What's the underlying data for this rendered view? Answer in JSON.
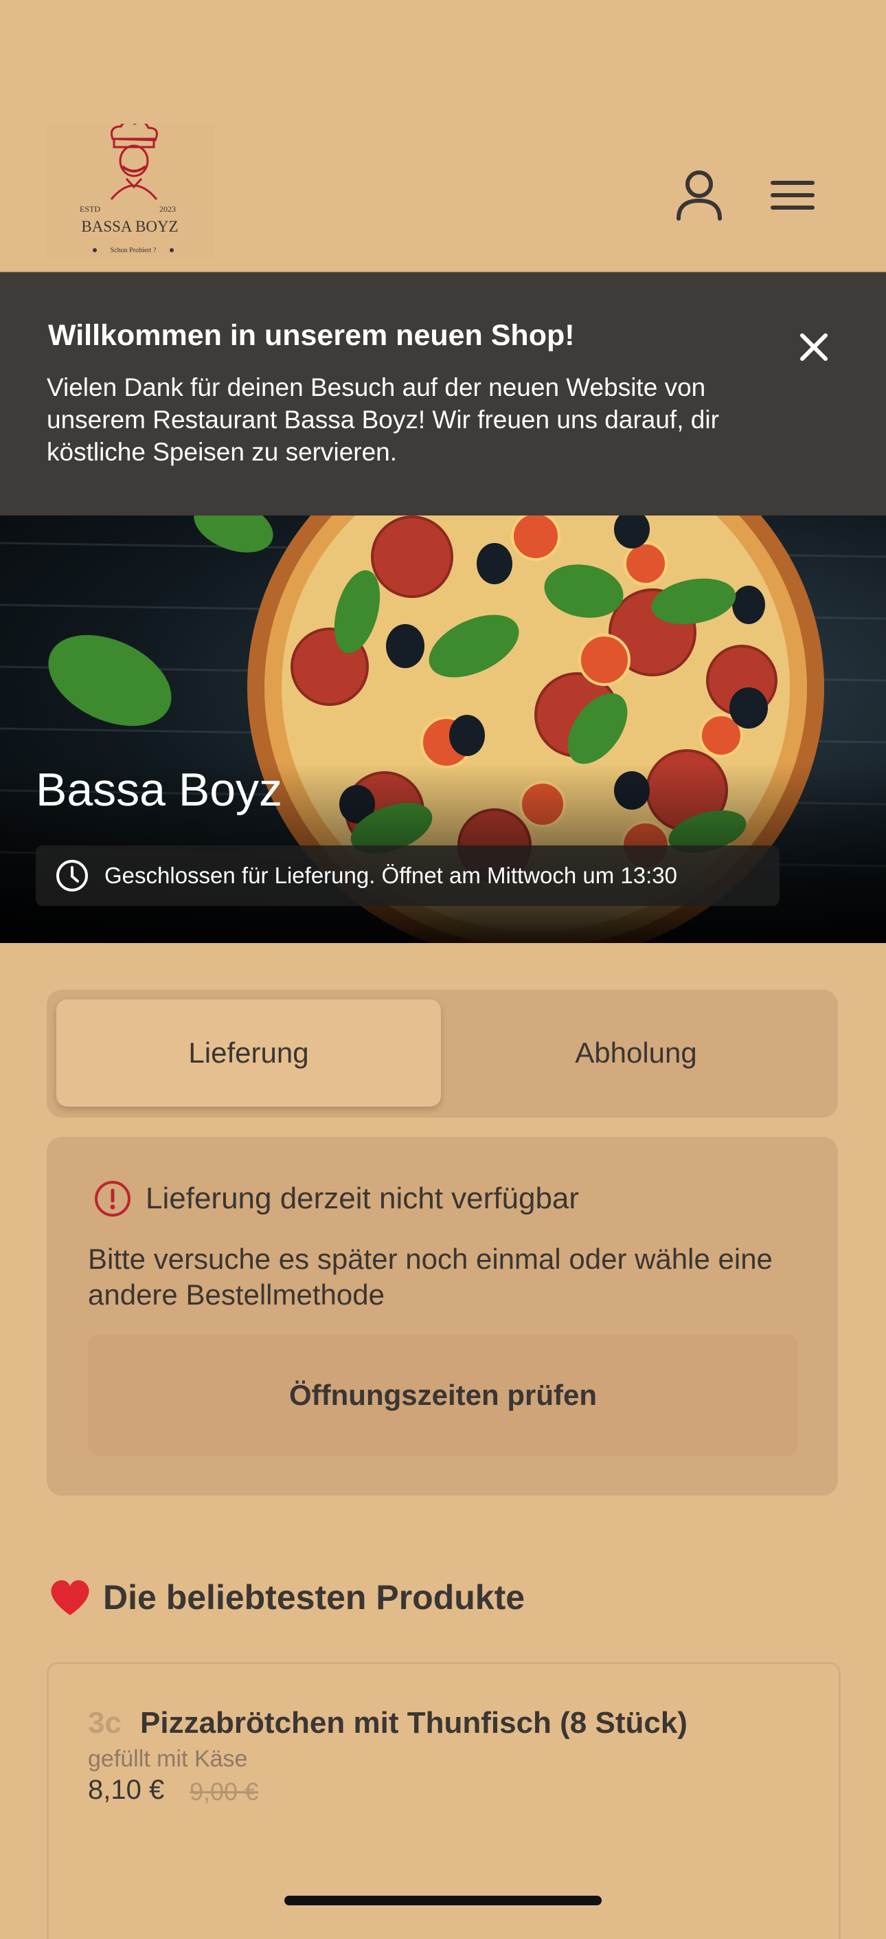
{
  "header": {
    "logo": {
      "estd": "ESTD",
      "year": "2023",
      "name": "BASSA BOYZ",
      "tagline": "Schon Probiert ?"
    },
    "account_icon": "person-icon",
    "menu_icon": "hamburger-menu-icon"
  },
  "banner": {
    "title": "Willkommen in unserem neuen Shop!",
    "text": "Vielen Dank für deinen Besuch auf der neuen Website von unserem Restaurant Bassa Boyz! Wir freuen uns darauf, dir köstliche Speisen zu servieren.",
    "close_icon": "close-icon"
  },
  "hero": {
    "title": "Bassa Boyz",
    "status": "Geschlossen für Lieferung. Öffnet am Mittwoch um 13:30",
    "status_icon": "clock-icon"
  },
  "order_mode": {
    "tabs": [
      {
        "label": "Lieferung",
        "active": true
      },
      {
        "label": "Abholung",
        "active": false
      }
    ]
  },
  "notice": {
    "icon": "info-icon",
    "title": "Lieferung derzeit nicht verfügbar",
    "text": "Bitte versuche es später noch einmal oder wähle eine andere Bestellmethode",
    "button": "Öffnungszeiten prüfen"
  },
  "popular": {
    "icon": "heart-icon",
    "title": "Die beliebtesten Produkte",
    "products": [
      {
        "code": "3c",
        "name": "Pizzabrötchen mit Thunfisch (8 Stück)",
        "description": "gefüllt mit Käse",
        "price": "8,10 €",
        "old_price": "9,00 €"
      }
    ]
  },
  "colors": {
    "background": "#e2bb8b",
    "banner": "#3e3b38",
    "card": "#d3aa7d",
    "text": "#3a3633",
    "accent_red": "#b9272f"
  }
}
